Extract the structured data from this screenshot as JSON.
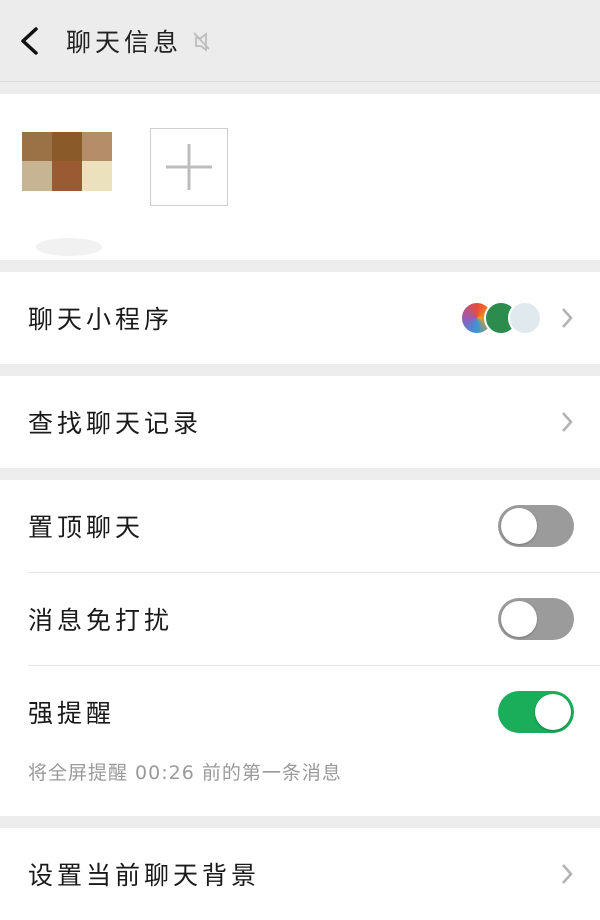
{
  "header": {
    "title": "聊天信息",
    "back_icon": "back-arrow-icon",
    "mute_icon": "mute-icon"
  },
  "members": {
    "add_icon": "plus-icon"
  },
  "rows": {
    "mini_programs": "聊天小程序",
    "search_history": "查找聊天记录",
    "pin_chat": "置顶聊天",
    "mute_notifications": "消息免打扰",
    "strong_reminder": "强提醒",
    "strong_reminder_note": "将全屏提醒 00:26 前的第一条消息",
    "chat_background": "设置当前聊天背景"
  },
  "toggles": {
    "pin_chat": false,
    "mute_notifications": false,
    "strong_reminder": true
  },
  "colors": {
    "accent_green": "#1aad5a",
    "toggle_off": "#9b9b9b",
    "bg": "#ededed"
  }
}
